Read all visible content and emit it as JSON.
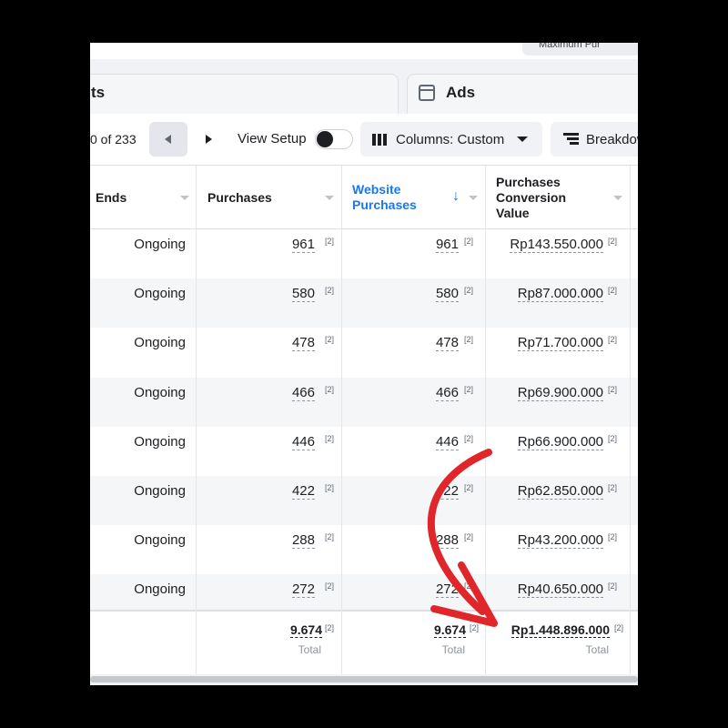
{
  "top": {
    "button_text": "Maximum Pur"
  },
  "tabs": {
    "left_label": "ts",
    "right_label": "Ads"
  },
  "toolbar": {
    "pagination_text": "0 of 233",
    "view_setup_label": "View Setup",
    "view_setup_on": false,
    "columns_label": "Columns: Custom",
    "breakdown_label": "Breakdown"
  },
  "table": {
    "headers": {
      "ends": "Ends",
      "purchases": "Purchases",
      "website_purchases_1": "Website",
      "website_purchases_2": "Purchases",
      "conv_value_1": "Purchases",
      "conv_value_2": "Conversion",
      "conv_value_3": "Value",
      "sort_arrow": "↓"
    },
    "rows": [
      {
        "ends": "Ongoing",
        "purchases": "961",
        "website_purchases": "961",
        "conversion_value": "Rp143.550.000",
        "ref": "[2]"
      },
      {
        "ends": "Ongoing",
        "purchases": "580",
        "website_purchases": "580",
        "conversion_value": "Rp87.000.000",
        "ref": "[2]"
      },
      {
        "ends": "Ongoing",
        "purchases": "478",
        "website_purchases": "478",
        "conversion_value": "Rp71.700.000",
        "ref": "[2]"
      },
      {
        "ends": "Ongoing",
        "purchases": "466",
        "website_purchases": "466",
        "conversion_value": "Rp69.900.000",
        "ref": "[2]"
      },
      {
        "ends": "Ongoing",
        "purchases": "446",
        "website_purchases": "446",
        "conversion_value": "Rp66.900.000",
        "ref": "[2]"
      },
      {
        "ends": "Ongoing",
        "purchases": "422",
        "website_purchases": "422",
        "conversion_value": "Rp62.850.000",
        "ref": "[2]"
      },
      {
        "ends": "Ongoing",
        "purchases": "288",
        "website_purchases": "288",
        "conversion_value": "Rp43.200.000",
        "ref": "[2]"
      },
      {
        "ends": "Ongoing",
        "purchases": "272",
        "website_purchases": "272",
        "conversion_value": "Rp40.650.000",
        "ref": "[2]"
      }
    ],
    "totals": {
      "purchases": "9.674",
      "website_purchases": "9.674",
      "conversion_value": "Rp1.448.896.000",
      "ref": "[2]",
      "label": "Total"
    }
  },
  "colors": {
    "accent": "#1877f2",
    "arrow": "#e0262a",
    "backdrop": "#000000"
  },
  "icons": [
    "ads-icon",
    "chevron-left-icon",
    "chevron-right-icon",
    "columns-icon",
    "caret-down-icon",
    "breakdown-icon",
    "sort-down-icon",
    "curved-arrow-annotation"
  ]
}
